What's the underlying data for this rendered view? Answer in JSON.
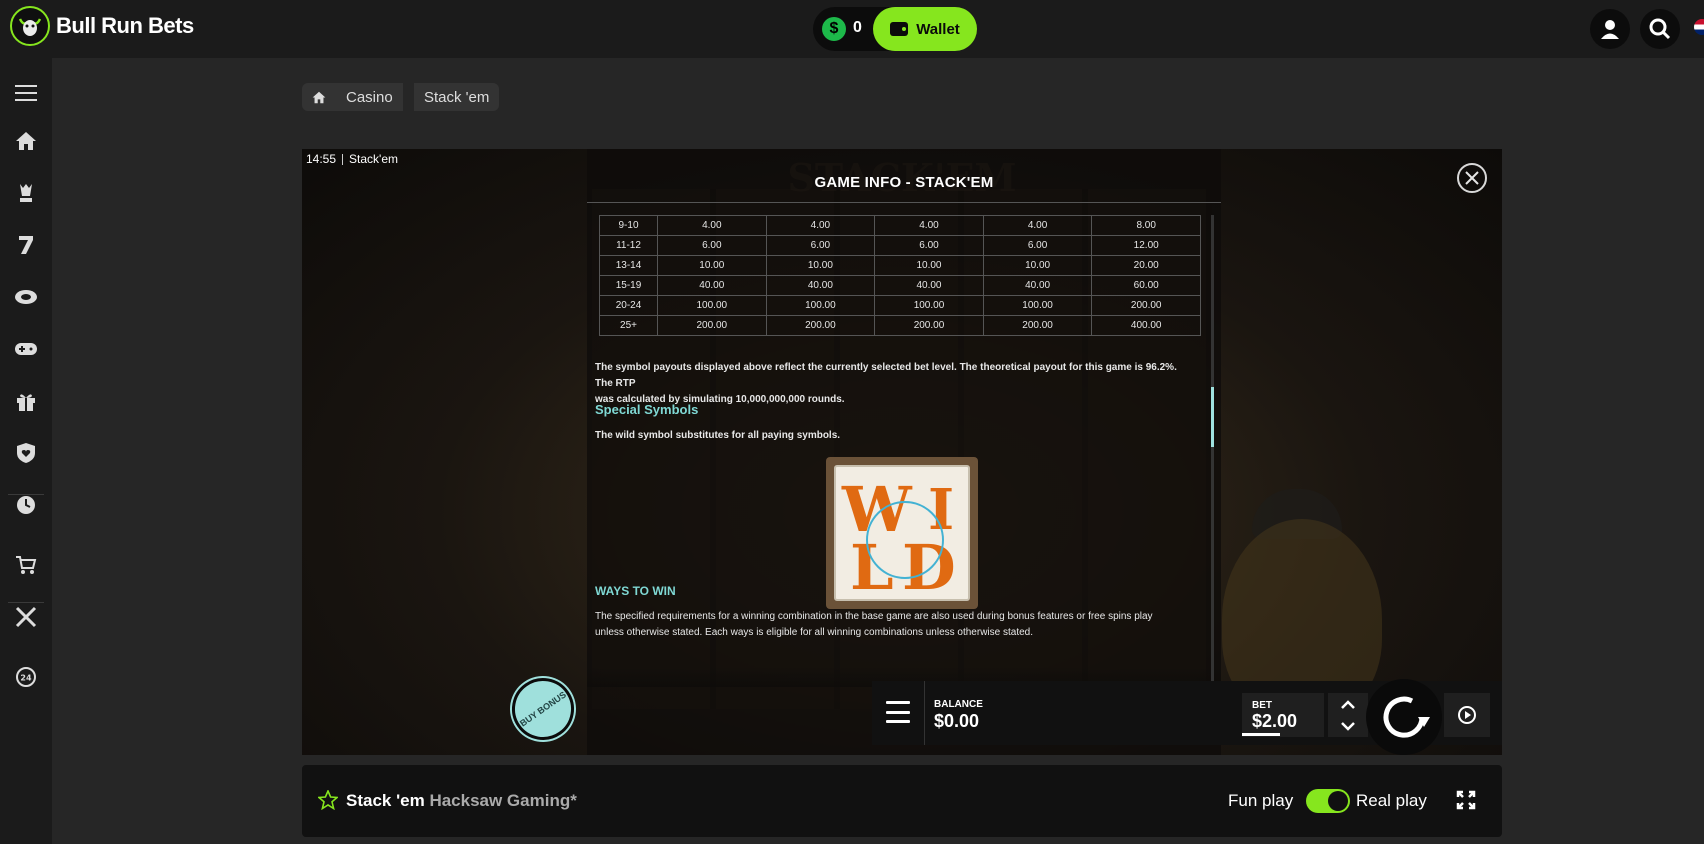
{
  "brand": {
    "name": "Bull Run Bets"
  },
  "header": {
    "balance": "0",
    "wallet_label": "Wallet"
  },
  "breadcrumb": {
    "casino": "Casino",
    "game": "Stack 'em"
  },
  "game": {
    "clock": "14:55",
    "window_title": "Stack'em",
    "info_title": "GAME INFO - STACK'EM",
    "paytable": [
      [
        "9-10",
        "4.00",
        "4.00",
        "4.00",
        "4.00",
        "8.00"
      ],
      [
        "11-12",
        "6.00",
        "6.00",
        "6.00",
        "6.00",
        "12.00"
      ],
      [
        "13-14",
        "10.00",
        "10.00",
        "10.00",
        "10.00",
        "20.00"
      ],
      [
        "15-19",
        "40.00",
        "40.00",
        "40.00",
        "40.00",
        "60.00"
      ],
      [
        "20-24",
        "100.00",
        "100.00",
        "100.00",
        "100.00",
        "200.00"
      ],
      [
        "25+",
        "200.00",
        "200.00",
        "200.00",
        "200.00",
        "400.00"
      ]
    ],
    "rtp_text_1": "The symbol payouts displayed above reflect the currently selected bet level. The theoretical payout for this game is 96.2%. The RTP",
    "rtp_text_2": "was calculated by simulating 10,000,000,000 rounds.",
    "special_heading": "Special Symbols",
    "wild_text": "The wild symbol substitutes for all paying symbols.",
    "wild_letters": {
      "w": "W",
      "i": "I",
      "l": "L",
      "d": "D"
    },
    "ways_heading": "WAYS TO WIN",
    "ways_text_1": "The specified requirements for a winning combination in the base game are also used during bonus features or free spins play",
    "ways_text_2": "unless otherwise stated. Each ways is eligible for all winning combinations unless otherwise stated.",
    "buy_bonus": "BUY BONUS",
    "balance_label": "BALANCE",
    "balance_value": "$0.00",
    "bet_label": "BET",
    "bet_value": "$2.00"
  },
  "bottom": {
    "game_name": "Stack 'em",
    "provider": "Hacksaw Gaming*",
    "fun_label": "Fun play",
    "real_label": "Real play"
  },
  "colors": {
    "accent": "#86e61e",
    "teal": "#7fd8d4",
    "background": "#262626"
  }
}
